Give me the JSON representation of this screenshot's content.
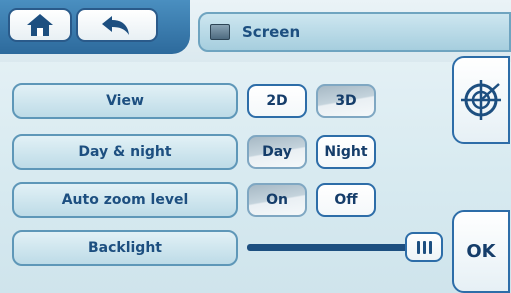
{
  "header": {
    "title": "Screen",
    "home_icon": "home-icon",
    "back_icon": "back-arrow-icon",
    "title_icon": "screen-icon"
  },
  "settings": [
    {
      "label": "View",
      "options": [
        "2D",
        "3D"
      ],
      "selected": "2D"
    },
    {
      "label": "Day & night",
      "options": [
        "Day",
        "Night"
      ],
      "selected": "Night"
    },
    {
      "label": "Auto zoom level",
      "options": [
        "On",
        "Off"
      ],
      "selected": "Off"
    },
    {
      "label": "Backlight",
      "slider_value": 0.95
    }
  ],
  "side": {
    "target_icon": "crosshair-target-icon",
    "ok_label": "OK"
  },
  "colors": {
    "accent": "#1d4f80",
    "button_border": "#2d6da8"
  }
}
